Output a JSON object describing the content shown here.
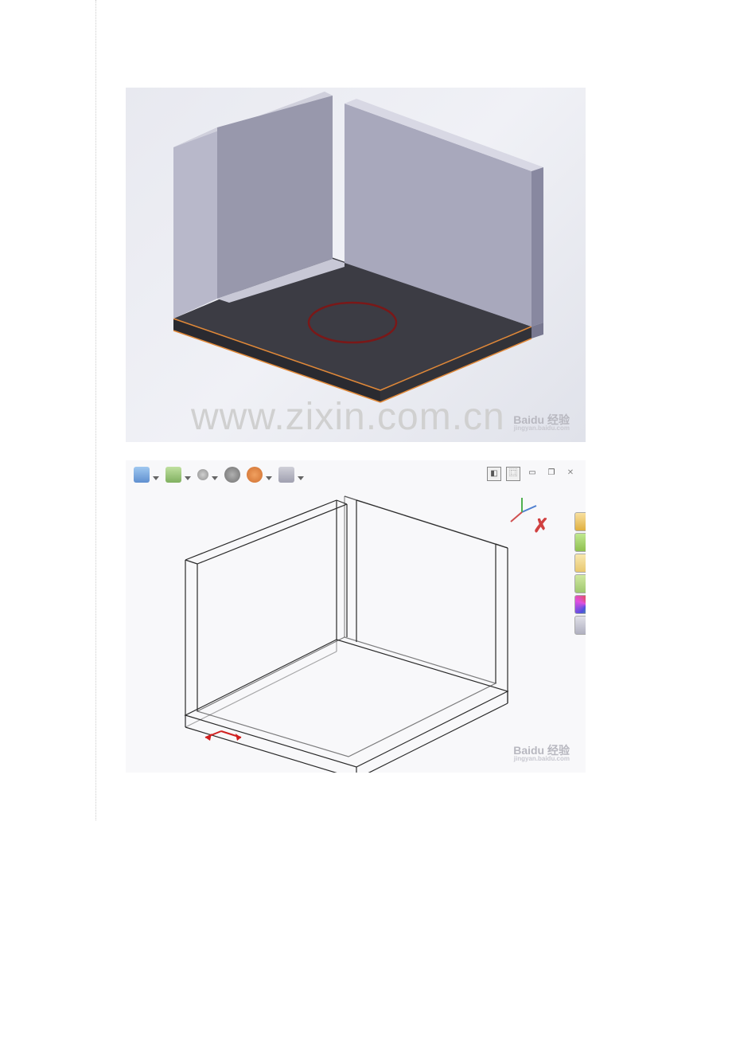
{
  "watermark": {
    "main": "www.zixin.com.cn",
    "baidu": "Baidu 经验",
    "baidu_sub": "jingyan.baidu.com"
  },
  "toolbar": {
    "icons": [
      "new-file",
      "view",
      "display",
      "sphere",
      "appearance",
      "settings"
    ]
  },
  "window": {
    "controls": [
      "panel1",
      "panel2",
      "minimize",
      "maximize",
      "close"
    ]
  },
  "taskpane": {
    "items": [
      "home",
      "library",
      "file",
      "design",
      "appearance",
      "options"
    ]
  },
  "triad": {
    "axes": [
      "x",
      "y",
      "z"
    ]
  },
  "colors": {
    "part_shade": "#9a9ab0",
    "part_light": "#c8c8d8",
    "part_dark": "#6a6a80",
    "selected_face": "#3a3a42",
    "selected_edge": "#e08030",
    "sketch_circle": "#8b2020",
    "wireframe": "#333333"
  }
}
